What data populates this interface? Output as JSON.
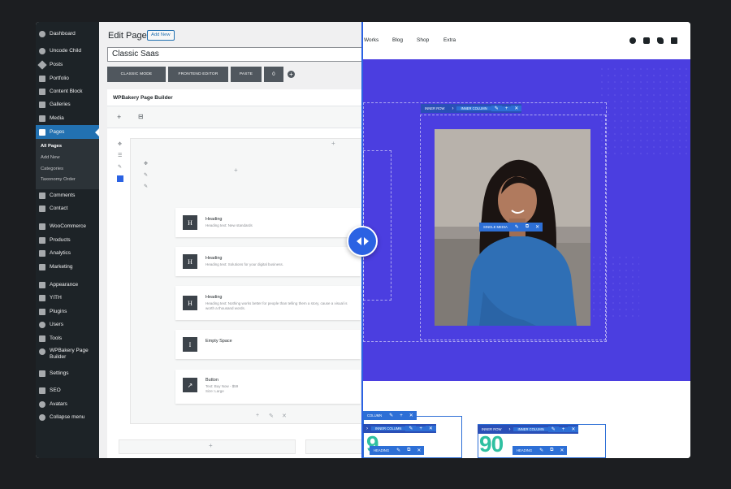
{
  "sidebar": {
    "items": [
      {
        "label": "Dashboard",
        "icon": "dashboard-icon"
      },
      {
        "label": "Uncode Child",
        "icon": "theme-icon"
      },
      {
        "label": "Posts",
        "icon": "pin-icon"
      },
      {
        "label": "Portfolio",
        "icon": "portfolio-icon"
      },
      {
        "label": "Content Block",
        "icon": "content-block-icon"
      },
      {
        "label": "Galleries",
        "icon": "gallery-icon"
      },
      {
        "label": "Media",
        "icon": "media-icon"
      },
      {
        "label": "Pages",
        "icon": "pages-icon"
      },
      {
        "label": "Comments",
        "icon": "comments-icon"
      },
      {
        "label": "Contact",
        "icon": "contact-icon"
      },
      {
        "label": "WooCommerce",
        "icon": "woocommerce-icon"
      },
      {
        "label": "Products",
        "icon": "products-icon"
      },
      {
        "label": "Analytics",
        "icon": "analytics-icon"
      },
      {
        "label": "Marketing",
        "icon": "marketing-icon"
      },
      {
        "label": "Appearance",
        "icon": "appearance-icon"
      },
      {
        "label": "YITH",
        "icon": "yith-icon"
      },
      {
        "label": "Plugins",
        "icon": "plugins-icon"
      },
      {
        "label": "Users",
        "icon": "users-icon"
      },
      {
        "label": "Tools",
        "icon": "tools-icon"
      },
      {
        "label": "WPBakery Page Builder",
        "icon": "wpbakery-icon"
      },
      {
        "label": "Settings",
        "icon": "settings-icon"
      },
      {
        "label": "SEO",
        "icon": "seo-icon"
      },
      {
        "label": "Avatars",
        "icon": "avatars-icon"
      },
      {
        "label": "Collapse menu",
        "icon": "collapse-icon"
      }
    ],
    "submenu": [
      "All Pages",
      "Add New",
      "Categories",
      "Taxonomy Order"
    ]
  },
  "editor": {
    "heading": "Edit Page",
    "add_new": "Add New",
    "title_value": "Classic Saas",
    "modes": [
      "Classic Mode",
      "Frontend Editor",
      "Paste"
    ],
    "counter": "0",
    "builder_title": "WPBakery Page Builder",
    "elements": [
      {
        "icon_letter": "H",
        "title": "Heading",
        "sub": "Heading text: New standards"
      },
      {
        "icon_letter": "H",
        "title": "Heading",
        "sub": "Heading text: Solutions for your digital business."
      },
      {
        "icon_letter": "H",
        "title": "Heading",
        "sub": "Heading text: Nothing works better for people than telling them a story, cause a visual is worth a thousand words."
      },
      {
        "icon_letter": "I",
        "title": "Empty Space",
        "sub": ""
      },
      {
        "icon_letter": "↗",
        "title": "Button",
        "sub": "Text: Buy Now - $59",
        "sub2": "Size: Large"
      }
    ]
  },
  "frontend": {
    "nav": [
      "Works",
      "Blog",
      "Shop",
      "Extra"
    ],
    "social_icons": [
      "facebook-icon",
      "youtube-icon",
      "twitter-icon",
      "social-icon"
    ],
    "toolbars": {
      "inner_row": "Inner Row",
      "inner_column": "Inner Column",
      "single_media": "Single Media",
      "column": "Column",
      "heading": "Heading"
    },
    "numbers": [
      "9",
      "90"
    ]
  },
  "colors": {
    "wp_sidebar": "#1d2327",
    "wp_accent": "#2271b1",
    "hero_bg": "#4b3ee0",
    "builder_blue": "#2d6fd6",
    "number_green": "#2fc0a1"
  }
}
